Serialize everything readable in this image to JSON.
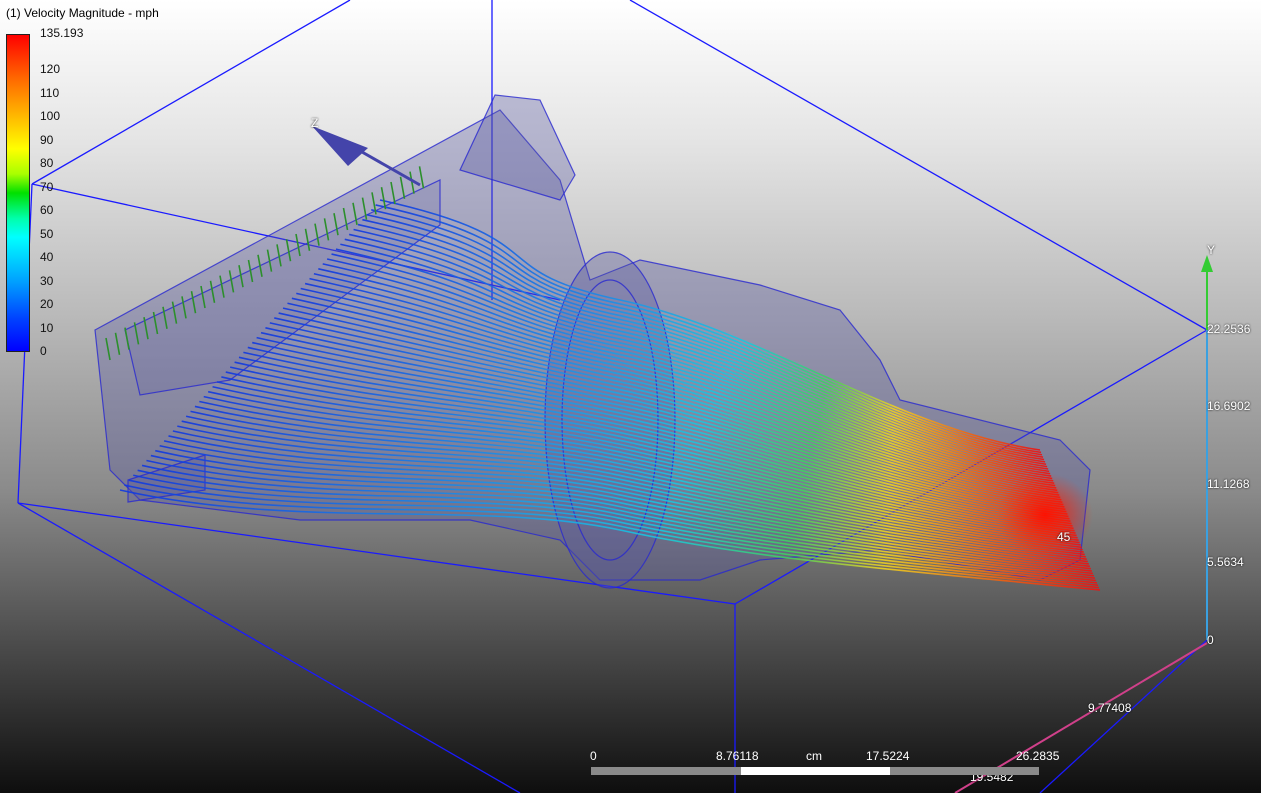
{
  "legend": {
    "title": "(1) Velocity Magnitude - mph",
    "max_label": "135.193",
    "ticks": [
      "120",
      "110",
      "100",
      "90",
      "80",
      "70",
      "60",
      "50",
      "40",
      "30",
      "20",
      "10",
      "0"
    ]
  },
  "axes": {
    "z_label": "Z",
    "y_label": "Y",
    "y_ticks": [
      "22.2536",
      "16.6902",
      "11.1268",
      "5.5634",
      "0"
    ],
    "x_ticks": [
      "9.77408",
      "19.5482"
    ],
    "partial_label": "45"
  },
  "scale": {
    "labels": [
      "0",
      "8.76118",
      "17.5224",
      "26.2835"
    ],
    "unit": "cm"
  },
  "colors": {
    "box": "#1a1aff",
    "body": "#6a6aa8",
    "y_axis": "#33cc33"
  }
}
